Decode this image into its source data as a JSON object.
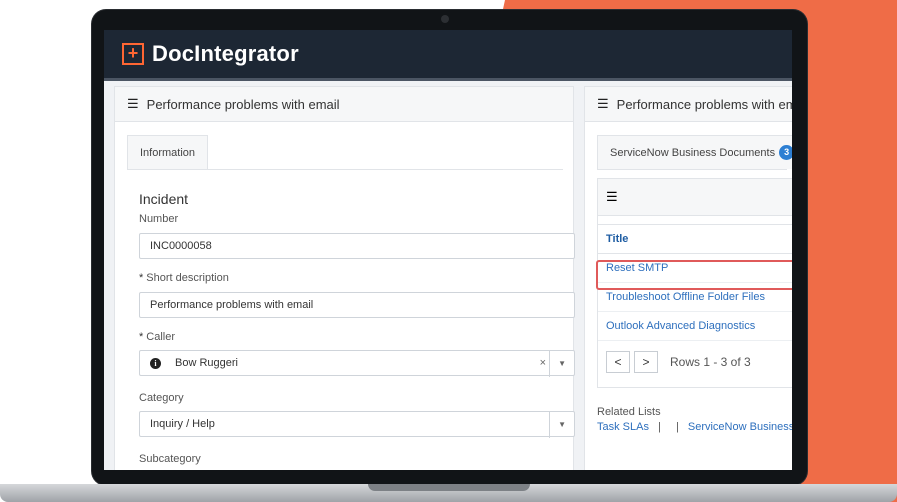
{
  "app": {
    "name": "DocIntegrator"
  },
  "left_panel": {
    "title": "Performance problems with email",
    "tab": "Information",
    "section_title": "Incident",
    "fields": {
      "number": {
        "label": "Number",
        "value": "INC0000058"
      },
      "short_description": {
        "required_mark": "*",
        "label": "Short description",
        "value": "Performance problems with email"
      },
      "caller": {
        "required_mark": "*",
        "label": "Caller",
        "value": "Bow Ruggeri",
        "clear": "×",
        "arrow": "▼"
      },
      "category": {
        "label": "Category",
        "value": "Inquiry / Help",
        "arrow": "▼"
      },
      "subcategory": {
        "label": "Subcategory"
      }
    }
  },
  "right_panel": {
    "title": "Performance problems with emai",
    "tab": {
      "label": "ServiceNow Business Documents",
      "badge": "3"
    },
    "list": {
      "column_title": "Title",
      "rows": [
        "Reset SMTP",
        "Troubleshoot Offline Folder Files",
        "Outlook Advanced Diagnostics"
      ],
      "pager": {
        "prev": "<",
        "next": ">",
        "text": "Rows 1 - 3 of 3"
      }
    },
    "related": {
      "label": "Related Lists",
      "link1": "Task SLAs",
      "separator": "|",
      "link2": "ServiceNow Business Do"
    }
  },
  "colors": {
    "accent": "#ef6c47",
    "header_bg": "#1d2734",
    "link": "#2d6fbd",
    "highlight": "#e05a5a"
  }
}
